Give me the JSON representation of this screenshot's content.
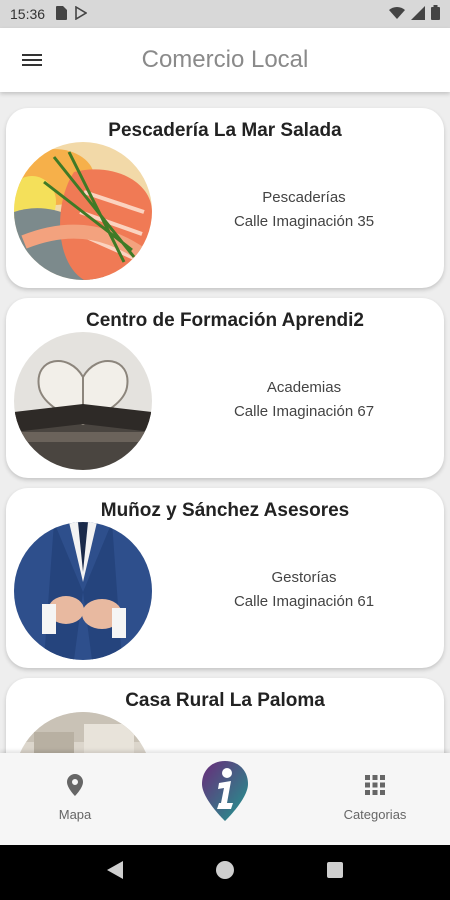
{
  "status_bar": {
    "time": "15:36",
    "left_icons": [
      "sim-card-icon",
      "play-store-icon"
    ],
    "right_icons": [
      "wifi-icon",
      "signal-icon",
      "battery-icon"
    ]
  },
  "app_bar": {
    "title": "Comercio Local",
    "menu_icon": "hamburger-menu-icon"
  },
  "businesses": [
    {
      "name": "Pescadería La Mar Salada",
      "category": "Pescaderías",
      "address": "Calle Imaginación 35"
    },
    {
      "name": "Centro de Formación Aprendi2",
      "category": "Academias",
      "address": "Calle Imaginación 67"
    },
    {
      "name": "Muñoz y Sánchez Asesores",
      "category": "Gestorías",
      "address": "Calle Imaginación 61"
    },
    {
      "name": "Casa Rural La Paloma",
      "category": "",
      "address": ""
    }
  ],
  "bottom_nav": {
    "map_label": "Mapa",
    "categories_label": "Categorias",
    "map_icon": "location-pin-icon",
    "categories_icon": "grid-icon",
    "center_icon": "info-pin-logo-icon"
  },
  "colors": {
    "app_bar_bg": "#ffffff",
    "title_color": "#8a8a8a",
    "card_bg": "#ffffff",
    "page_bg": "#eeeeee",
    "logo_purple": "#6a2a7a",
    "logo_teal": "#1f9a8f"
  }
}
